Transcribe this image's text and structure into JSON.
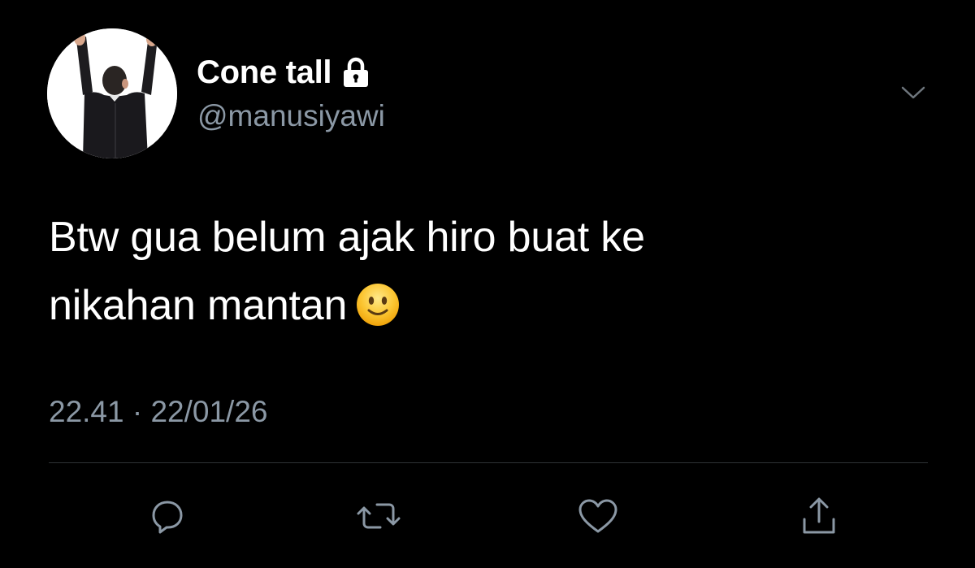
{
  "colors": {
    "background": "#000000",
    "text_primary": "#ffffff",
    "text_secondary": "#8b98a5",
    "divider": "#2f3336"
  },
  "user": {
    "display_name": "Cone tall",
    "handle": "@manusiyawi",
    "protected_icon": "lock-icon",
    "avatar": "avatar-man-in-suit-arms-raised"
  },
  "tweet": {
    "text_lines": [
      "Btw gua belum ajak hiro buat ke",
      "nikahan mantan"
    ],
    "emoji": "slightly-smiling-face-icon",
    "timestamp": "22.41 · 22/01/26"
  },
  "menu": {
    "icon": "chevron-down-icon"
  },
  "actions": [
    {
      "icon": "reply-icon"
    },
    {
      "icon": "retweet-icon"
    },
    {
      "icon": "like-icon"
    },
    {
      "icon": "share-icon"
    }
  ]
}
